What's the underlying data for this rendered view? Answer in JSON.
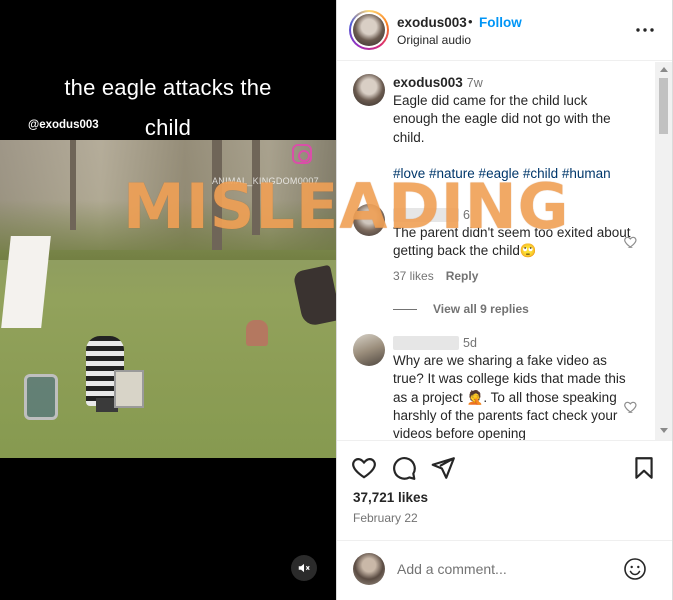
{
  "media": {
    "caption_line1": "the eagle attacks the",
    "caption_line2": "child",
    "handle": "@exodus003",
    "watermark": "ANIMAL_KINGDOM0007",
    "mute_icon": "speaker-muted-icon"
  },
  "overlay": {
    "stamp_text": "MISLEADING",
    "stamp_color": "#f0a055"
  },
  "post": {
    "username": "exodus003",
    "separator": "•",
    "follow_label": "Follow",
    "audio_label": "Original audio",
    "more_icon": "more-options-icon"
  },
  "comments": [
    {
      "user": "exodus003",
      "time": "7w",
      "text": "Eagle did came for the child luck enough the eagle did not go with the child.",
      "tags": "#love #nature #eagle #child #human"
    },
    {
      "user": "",
      "time": "6",
      "text": "The parent didn't seem too exited about getting back the child",
      "emoji": "🙄",
      "likes_label": "37 likes",
      "reply_label": "Reply",
      "view_replies_label": "View all 9 replies"
    },
    {
      "user": "",
      "time": "5d",
      "text_before_emoji": "Why are we sharing a fake video as true? It was college kids that made this as a project ",
      "emoji": "🤦",
      "text_after_emoji": ". To all those speaking harshly of the parents fact check your videos before opening"
    }
  ],
  "actions": {
    "likes": "37,721 likes",
    "date": "February 22",
    "icons": [
      "heart-icon",
      "comment-icon",
      "share-icon",
      "bookmark-icon"
    ]
  },
  "composer": {
    "placeholder": "Add a comment...",
    "emoji_icon": "emoji-icon"
  },
  "colors": {
    "follow": "#0095f6",
    "hashtag": "#00376b",
    "muted_text": "#737373"
  }
}
